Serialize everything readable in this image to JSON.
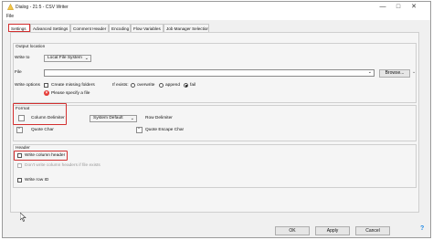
{
  "window": {
    "title": "Dialog - 21:5 - CSV Writer"
  },
  "menu": {
    "file": "File"
  },
  "tabs": [
    {
      "label": "Settings"
    },
    {
      "label": "Advanced Settings"
    },
    {
      "label": "Comment Header"
    },
    {
      "label": "Encoding"
    },
    {
      "label": "Flow Variables"
    },
    {
      "label": "Job Manager Selection"
    }
  ],
  "output_location": {
    "title": "Output location",
    "write_to_label": "Write to",
    "write_to_value": "Local File System",
    "file_label": "File",
    "file_value": "",
    "browse_label": "Browse...",
    "write_options_label": "Write options",
    "create_missing_folders": "Create missing folders",
    "if_exists_label": "If exists:",
    "overwrite": "overwrite",
    "append": "append",
    "fail": "fail",
    "error_text": "Please specify a file"
  },
  "format": {
    "title": "Format",
    "column_delimiter_label": "Column Delimiter",
    "column_delimiter_value": "",
    "row_delimiter_value": "System Default",
    "row_delimiter_label": "Row Delimiter",
    "quote_char_label": "Quote Char",
    "quote_char_value": "\"",
    "quote_escape_label": "Quote Escape Char",
    "quote_escape_value": "\""
  },
  "header": {
    "title": "Header",
    "write_column_header": "Write column header",
    "dont_write_if_exists": "Don't write column headers if file exists",
    "write_row_id": "Write row ID"
  },
  "buttons": {
    "ok": "OK",
    "apply": "Apply",
    "cancel": "Cancel"
  },
  "colors": {
    "highlight": "#d32f2f",
    "error": "#e53935"
  }
}
